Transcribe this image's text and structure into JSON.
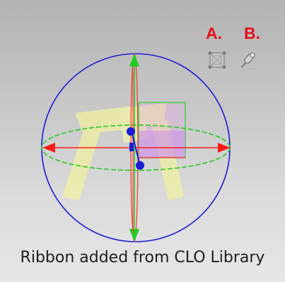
{
  "annotations": {
    "label_a": "A.",
    "label_b": "B."
  },
  "toolbar": {
    "tool_a_icon": "bounding-box-icon",
    "tool_b_icon": "pin-tool-icon"
  },
  "caption": "Ribbon added from CLO Library",
  "colors": {
    "annotation_red": "#e8101c",
    "x_axis": "#ff1a1a",
    "y_axis": "#22cc22",
    "z_axis": "#1b1bd8",
    "ribbon": "#f2f2a0"
  }
}
